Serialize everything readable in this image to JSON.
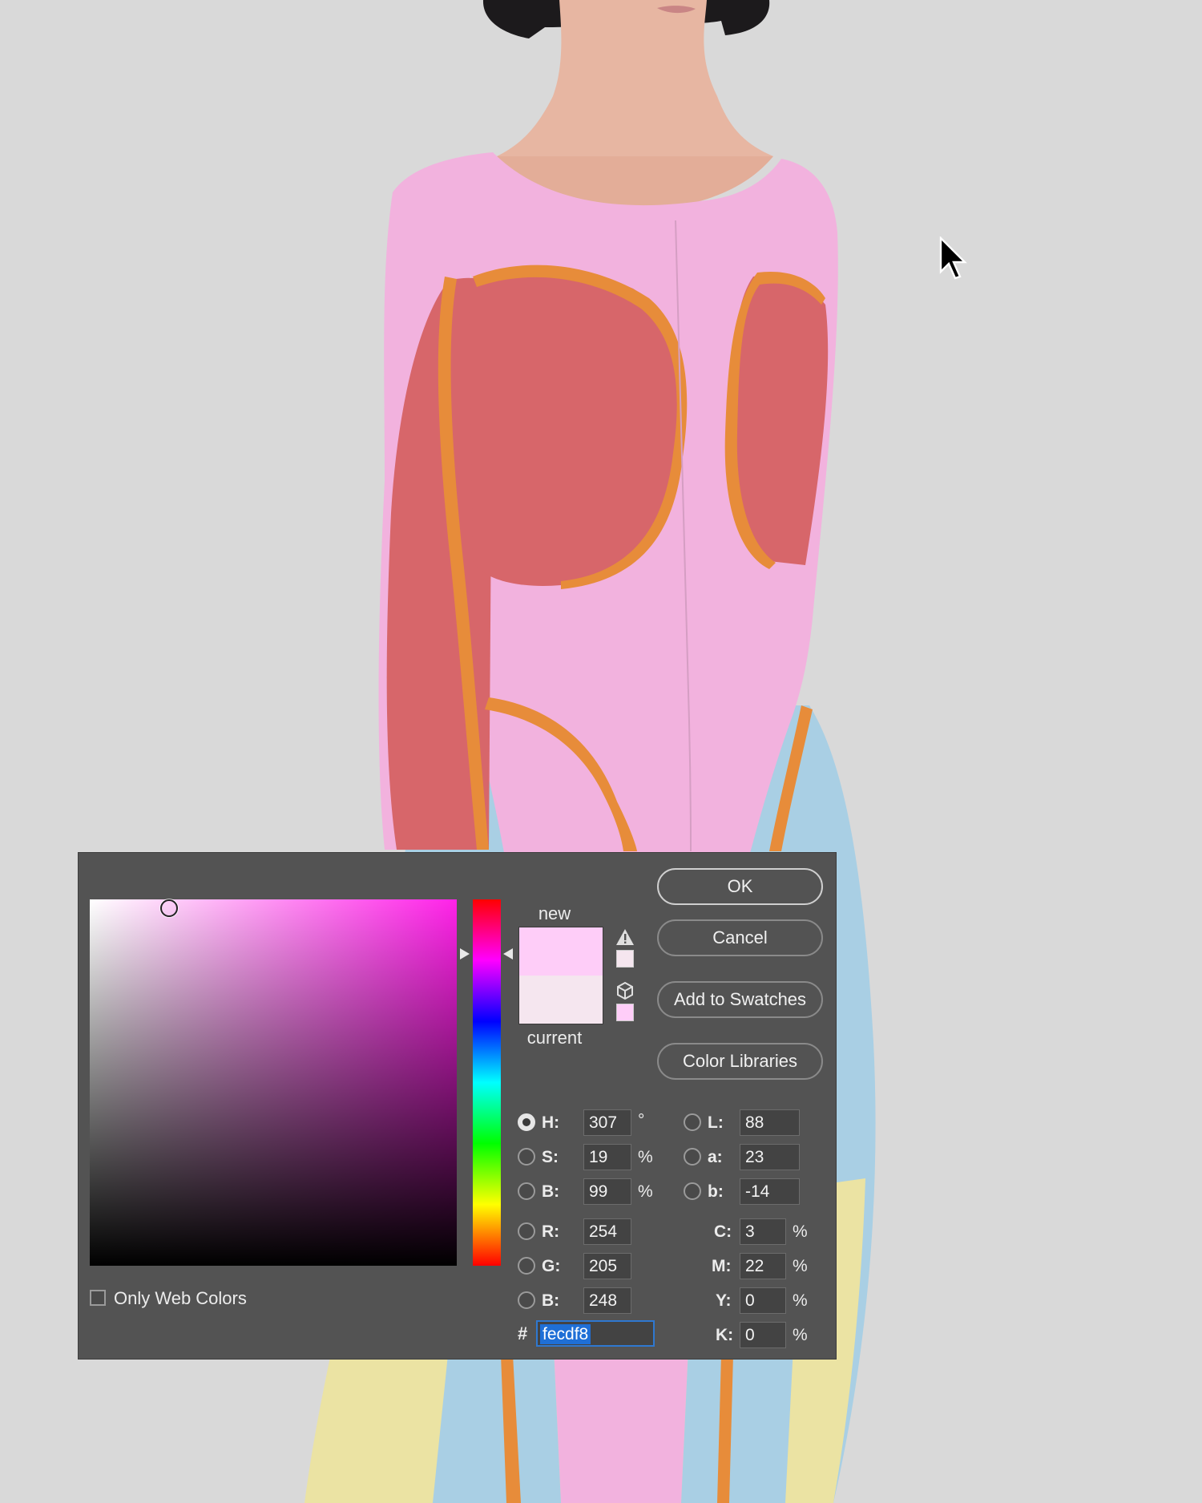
{
  "colors": {
    "background": "#d9d9d9",
    "dress_pink": "#f2b2de",
    "dress_red": "#d7666a",
    "trim_orange": "#e78c3a",
    "skirt_blue": "#a9cfe4",
    "skirt_yellow": "#ebe3a3",
    "dialog_bg": "#535353",
    "new_color": "#fecdf8",
    "current_color": "#f5e6ef",
    "selection_blue": "#1f6fd6"
  },
  "picker": {
    "new_label": "new",
    "current_label": "current",
    "buttons": {
      "ok": "OK",
      "cancel": "Cancel",
      "add_to_swatches": "Add to Swatches",
      "color_libraries": "Color Libraries"
    },
    "fields": {
      "h": {
        "label": "H:",
        "value": "307",
        "unit": "°"
      },
      "s": {
        "label": "S:",
        "value": "19",
        "unit": "%"
      },
      "bv": {
        "label": "B:",
        "value": "99",
        "unit": "%"
      },
      "r": {
        "label": "R:",
        "value": "254"
      },
      "g": {
        "label": "G:",
        "value": "205"
      },
      "bl": {
        "label": "B:",
        "value": "248"
      },
      "l": {
        "label": "L:",
        "value": "88"
      },
      "a": {
        "label": "a:",
        "value": "23"
      },
      "lb": {
        "label": "b:",
        "value": "-14"
      },
      "c": {
        "label": "C:",
        "value": "3",
        "unit": "%"
      },
      "m": {
        "label": "M:",
        "value": "22",
        "unit": "%"
      },
      "y": {
        "label": "Y:",
        "value": "0",
        "unit": "%"
      },
      "k": {
        "label": "K:",
        "value": "0",
        "unit": "%"
      }
    },
    "hex_symbol": "#",
    "hex": "fecdf8",
    "only_web_colors": "Only Web Colors",
    "only_web_colors_checked": false,
    "selected_mode": "H"
  }
}
